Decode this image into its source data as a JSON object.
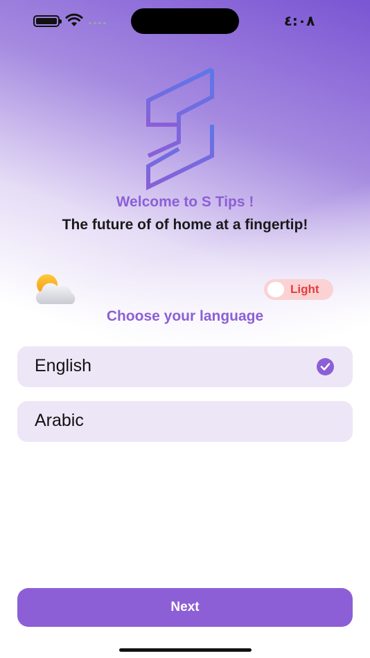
{
  "status_bar": {
    "time": "٤:٠٨"
  },
  "welcome": {
    "title": "Welcome to S Tips !",
    "tagline": "The future of of home at a fingertip!"
  },
  "theme": {
    "toggle_label": "Light",
    "weather_icon": "partly-cloudy-icon"
  },
  "language": {
    "heading": "Choose your language",
    "options": [
      {
        "label": "English",
        "selected": true
      },
      {
        "label": "Arabic",
        "selected": false
      }
    ]
  },
  "actions": {
    "next_label": "Next"
  },
  "colors": {
    "accent": "#8c5fd6",
    "option_bg": "#ede6f7",
    "toggle_bg": "#fbd2d4",
    "toggle_text": "#e23d3d"
  }
}
